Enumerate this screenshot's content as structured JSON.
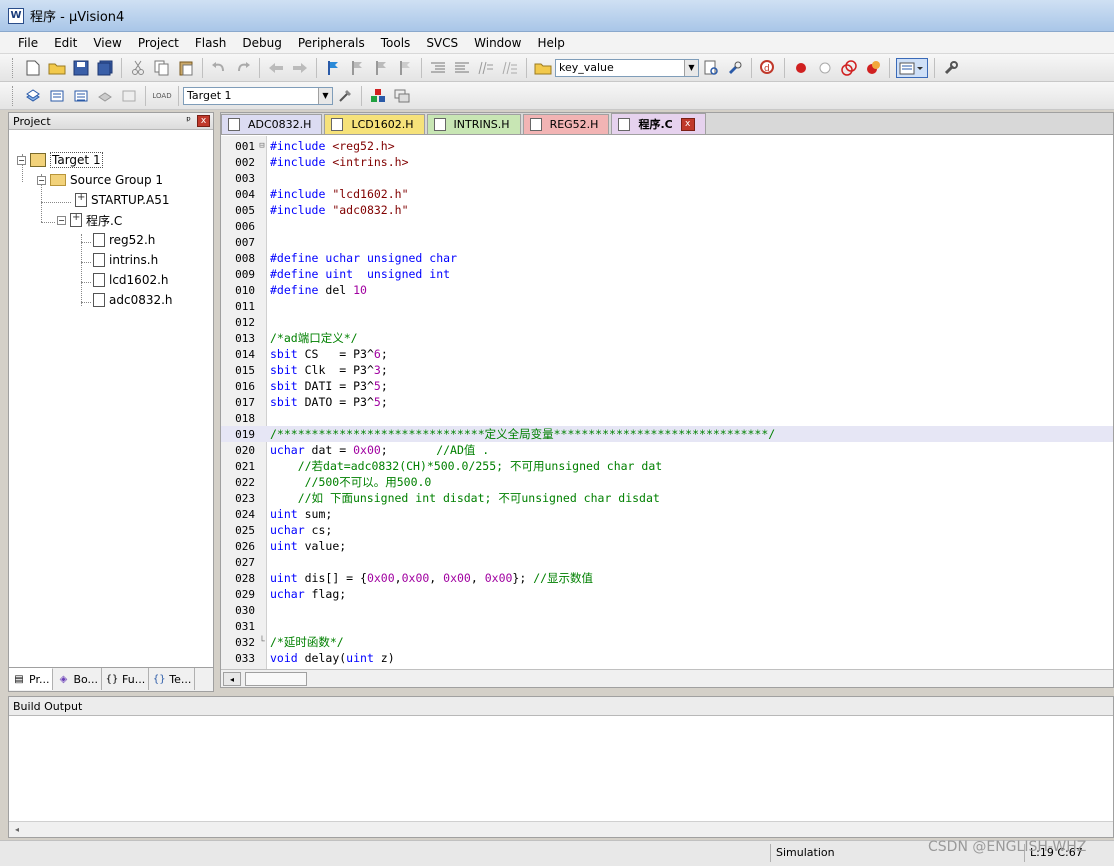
{
  "window": {
    "title": "程序 - µVision4",
    "icon_letter": "W"
  },
  "menu": [
    "File",
    "Edit",
    "View",
    "Project",
    "Flash",
    "Debug",
    "Peripherals",
    "Tools",
    "SVCS",
    "Window",
    "Help"
  ],
  "toolbar": {
    "find_combo_value": "key_value",
    "target_combo_value": "Target 1",
    "load_label": "LOAD"
  },
  "project_panel": {
    "title": "Project",
    "pin_glyph": "ᵖ",
    "close_glyph": "x",
    "tree": {
      "target": "Target 1",
      "group": "Source Group 1",
      "startup": "STARTUP.A51",
      "main_file": "程序.C",
      "includes": [
        "reg52.h",
        "intrins.h",
        "lcd1602.h",
        "adc0832.h"
      ]
    },
    "tabs": [
      "Pr...",
      "Bo...",
      "Fu...",
      "Te..."
    ],
    "tab_icons": [
      "▤",
      "◈",
      "{}",
      "{}"
    ]
  },
  "editor": {
    "tabs": [
      {
        "label": "ADC0832.H",
        "color": "#dcdcf2"
      },
      {
        "label": "LCD1602.H",
        "color": "#f6e27a"
      },
      {
        "label": "INTRINS.H",
        "color": "#c8e6b4"
      },
      {
        "label": "REG52.H",
        "color": "#f2b4b4"
      },
      {
        "label": "程序.C",
        "color": "#e6d2ee"
      }
    ],
    "close_glyph": "x",
    "lines": [
      {
        "n": "001",
        "fold": "⊟",
        "t": "#include <reg52.h>",
        "c": "kw"
      },
      {
        "n": "002",
        "fold": "",
        "t": "#include <intrins.h>",
        "c": "kw"
      },
      {
        "n": "003",
        "fold": "",
        "t": "",
        "c": ""
      },
      {
        "n": "004",
        "fold": "",
        "t": "#include \"lcd1602.h\"",
        "c": "inc"
      },
      {
        "n": "005",
        "fold": "",
        "t": "#include \"adc0832.h\"",
        "c": "inc"
      },
      {
        "n": "006",
        "fold": "",
        "t": "",
        "c": ""
      },
      {
        "n": "007",
        "fold": "",
        "t": "",
        "c": ""
      },
      {
        "n": "008",
        "fold": "",
        "t": "#define uchar unsigned char",
        "c": "kw"
      },
      {
        "n": "009",
        "fold": "",
        "t": "#define uint  unsigned int",
        "c": "kw"
      },
      {
        "n": "010",
        "fold": "",
        "t": "#define del 10",
        "c": "def"
      },
      {
        "n": "011",
        "fold": "",
        "t": "",
        "c": ""
      },
      {
        "n": "012",
        "fold": "",
        "t": "",
        "c": ""
      },
      {
        "n": "013",
        "fold": "",
        "t": "/*ad端口定义*/",
        "c": "cm"
      },
      {
        "n": "014",
        "fold": "",
        "t": "sbit CS   = P3^6;",
        "c": "kw"
      },
      {
        "n": "015",
        "fold": "",
        "t": "sbit Clk  = P3^3;",
        "c": "kw"
      },
      {
        "n": "016",
        "fold": "",
        "t": "sbit DATI = P3^5;",
        "c": "kw"
      },
      {
        "n": "017",
        "fold": "",
        "t": "sbit DATO = P3^5;",
        "c": "kw"
      },
      {
        "n": "018",
        "fold": "",
        "t": "",
        "c": ""
      },
      {
        "n": "019",
        "fold": "",
        "t": "/******************************定义全局变量*******************************/",
        "c": "cm",
        "hl": true
      },
      {
        "n": "020",
        "fold": "",
        "t": "uchar dat = 0x00;       //AD值 .",
        "c": "mix"
      },
      {
        "n": "021",
        "fold": "",
        "t": "    //若dat=adc0832(CH)*500.0/255; 不可用unsigned char dat",
        "c": "cm"
      },
      {
        "n": "022",
        "fold": "",
        "t": "     //500不可以。用500.0",
        "c": "cm"
      },
      {
        "n": "023",
        "fold": "",
        "t": "    //如 下面unsigned int disdat; 不可unsigned char disdat",
        "c": "cm"
      },
      {
        "n": "024",
        "fold": "",
        "t": "uint sum;",
        "c": "kw"
      },
      {
        "n": "025",
        "fold": "",
        "t": "uchar cs;",
        "c": "kw"
      },
      {
        "n": "026",
        "fold": "",
        "t": "uint value;",
        "c": "kw"
      },
      {
        "n": "027",
        "fold": "",
        "t": "",
        "c": ""
      },
      {
        "n": "028",
        "fold": "",
        "t": "uint dis[] = {0x00,0x00, 0x00, 0x00}; //显示数值",
        "c": "mix"
      },
      {
        "n": "029",
        "fold": "",
        "t": "uchar flag;",
        "c": "kw"
      },
      {
        "n": "030",
        "fold": "",
        "t": "",
        "c": ""
      },
      {
        "n": "031",
        "fold": "",
        "t": "",
        "c": ""
      },
      {
        "n": "032",
        "fold": "└",
        "t": "/*延时函数*/",
        "c": "cm"
      },
      {
        "n": "033",
        "fold": "",
        "t": "void delay(uint z)",
        "c": "kw"
      }
    ]
  },
  "build_output": {
    "title": "Build Output",
    "scroll_left": "◂"
  },
  "status": {
    "mode": "Simulation",
    "position": "L:19 C:67",
    "watermark": "CSDN @ENGLISH-WHZ"
  }
}
